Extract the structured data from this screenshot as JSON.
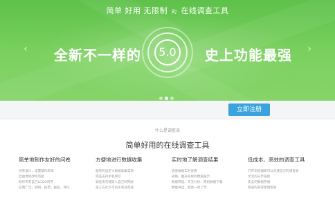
{
  "banner": {
    "title_part1": "简单 好用 无限制",
    "title_small": "的",
    "title_part2": "在线调查工具",
    "slogan_left": "全新不一样的",
    "version": "5.0",
    "slogan_right": "史上功能最强",
    "prev_arrow": "‹",
    "next_arrow": "›"
  },
  "actions": {
    "register_label": "立即注册"
  },
  "intro": {
    "what_label": "什么是调查派",
    "subtitle": "简单好用的在线调查工具"
  },
  "features": [
    {
      "title": "简单地制作友好的问卷",
      "lines": [
        "问卷设计，设置操作简单",
        "自由地修改所有题",
        "制作专有自己LOGO问卷",
        "应用广泛：调研，投票，报名，评比…"
      ]
    },
    {
      "title": "方便地进行数据收集",
      "lines": [
        "独有的自定义数据收集渠道",
        "完美支持手机填写",
        "调查表无缝嵌入自己的网站",
        "第三方社交平台多有效渠道"
      ]
    },
    {
      "title": "实时地了解调查结果",
      "lines": [
        "调查数据实时查看",
        "表格、图表多样的数据展示",
        "数据筛选、交叉分析，原始数据下载",
        "数据导出，趋势一目了然"
      ]
    },
    {
      "title": "低成本、高效的调查工具",
      "lines": [
        "打开浏览器即可以创建自己的调查表",
        "灵活的分享链接",
        "安全的数据存储",
        "快速的获得使用帮助"
      ]
    }
  ]
}
